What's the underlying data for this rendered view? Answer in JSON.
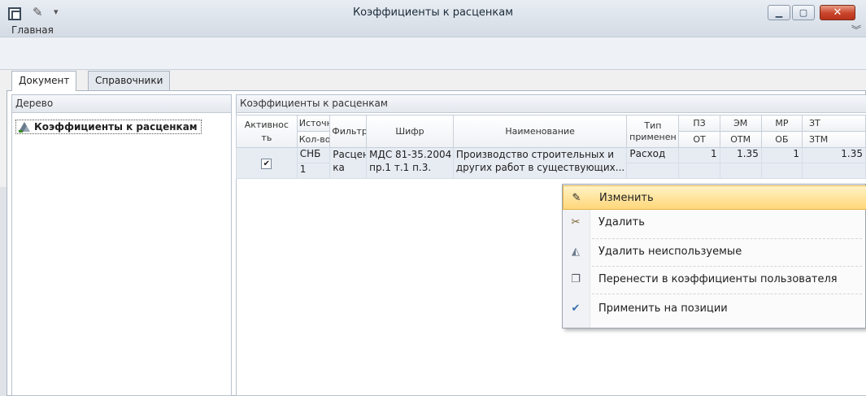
{
  "window": {
    "title": "Коэффициенты к расценкам",
    "ribbon_tab": "Главная"
  },
  "tabs": [
    {
      "label": "Документ",
      "active": true
    },
    {
      "label": "Справочники",
      "active": false
    }
  ],
  "tree": {
    "header": "Дерево",
    "item": "Коэффициенты к расценкам"
  },
  "grid": {
    "header": "Коэффициенты к расценкам",
    "columns": {
      "active": "Активнос ть",
      "source": "Источни",
      "qty": "Кол-во",
      "filter": "Фильтр",
      "cipher": "Шифр",
      "name": "Наименование",
      "type": "Тип применен",
      "pz": "ПЗ",
      "ot": "ОТ",
      "em": "ЭМ",
      "otm": "ОТМ",
      "mr": "МР",
      "ob": "ОБ",
      "zt": "ЗТ",
      "ztm": "ЗТМ"
    },
    "row": {
      "active": true,
      "source": "СНБ",
      "qty": "1",
      "filter_1": "Расцен",
      "filter_2": "ка",
      "cipher_1": "МДС 81-35.2004",
      "cipher_2": "пр.1 т.1 п.3.",
      "name_1": "Производство строительных и",
      "name_2": "других работ в существующих...",
      "type": "Расход",
      "pz": "1",
      "em": "1.35",
      "mr": "1",
      "zt": "1.35"
    }
  },
  "context_menu": [
    {
      "label": "Изменить",
      "icon": "edit-icon",
      "highlighted": true
    },
    {
      "label": "Удалить",
      "icon": "delete-icon",
      "highlighted": false
    },
    {
      "label": "Удалить неиспользуемые",
      "icon": "delete-unused-icon",
      "highlighted": false
    },
    {
      "label": "Перенести в коэффициенты пользователя",
      "icon": "transfer-icon",
      "highlighted": false
    },
    {
      "label": "Применить на позиции",
      "icon": "apply-icon",
      "highlighted": false
    }
  ],
  "colors": {
    "highlight": "#ffd77a",
    "selected_row": "#e7ecf3",
    "close_button": "#c8442a"
  }
}
